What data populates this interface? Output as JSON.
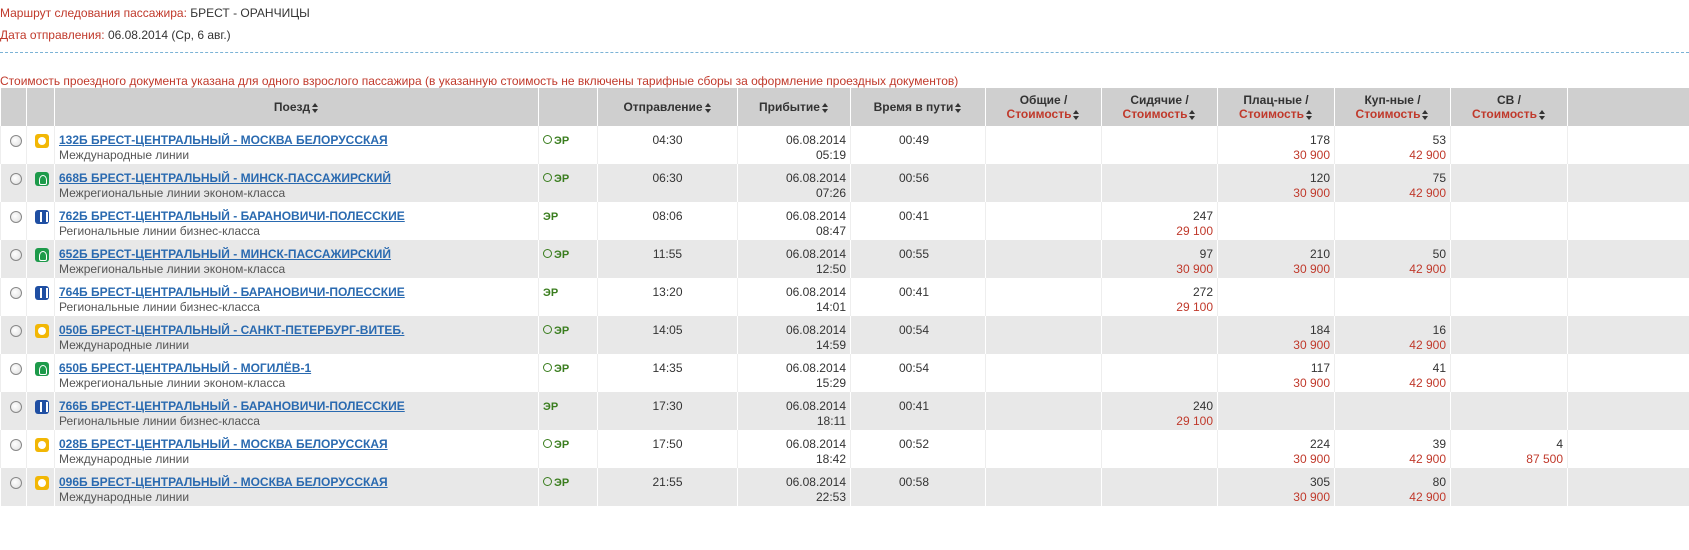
{
  "route": {
    "label": "Маршрут следования пассажира:",
    "value": "БРЕСТ - ОРАНЧИЦЫ"
  },
  "departure_date": {
    "label": "Дата отправления:",
    "value": "06.08.2014 (Ср, 6 авг.)"
  },
  "note": "Стоимость проездного документа указана для одного взрослого пассажира (в указанную стоимость не включены тарифные сборы за оформление проездных документов)",
  "headers": {
    "train": "Поезд",
    "departure": "Отправление",
    "arrival": "Прибытие",
    "travel_time": "Время в пути",
    "general": "Общие /",
    "seated": "Сидячие /",
    "platz": "Плац-ные /",
    "coupe": "Куп-ные /",
    "sv": "СВ /",
    "cost": "Стоимость"
  },
  "er_label": "ЭР",
  "trains": [
    {
      "name": "132Б БРЕСТ-ЦЕНТРАЛЬНЫЙ - МОСКВА БЕЛОРУССКАЯ",
      "category": "Международные линии",
      "icon": "intl-train-icon",
      "clock": true,
      "dep": "04:30",
      "arr_date": "06.08.2014",
      "arr_time": "05:19",
      "time": "00:49",
      "general": [
        "",
        ""
      ],
      "seated": [
        "",
        ""
      ],
      "platz": [
        "178",
        "30 900"
      ],
      "coupe": [
        "53",
        "42 900"
      ],
      "sv": [
        "",
        ""
      ]
    },
    {
      "name": "668Б БРЕСТ-ЦЕНТРАЛЬНЫЙ - МИНСК-ПАССАЖИРСКИЙ",
      "category": "Межрегиональные линии эконом-класса",
      "icon": "econ-train-icon",
      "clock": true,
      "dep": "06:30",
      "arr_date": "06.08.2014",
      "arr_time": "07:26",
      "time": "00:56",
      "general": [
        "",
        ""
      ],
      "seated": [
        "",
        ""
      ],
      "platz": [
        "120",
        "30 900"
      ],
      "coupe": [
        "75",
        "42 900"
      ],
      "sv": [
        "",
        ""
      ]
    },
    {
      "name": "762Б БРЕСТ-ЦЕНТРАЛЬНЫЙ - БАРАНОВИЧИ-ПОЛЕССКИЕ",
      "category": "Региональные линии бизнес-класса",
      "icon": "biz-train-icon",
      "clock": false,
      "dep": "08:06",
      "arr_date": "06.08.2014",
      "arr_time": "08:47",
      "time": "00:41",
      "general": [
        "",
        ""
      ],
      "seated": [
        "247",
        "29 100"
      ],
      "platz": [
        "",
        ""
      ],
      "coupe": [
        "",
        ""
      ],
      "sv": [
        "",
        ""
      ]
    },
    {
      "name": "652Б БРЕСТ-ЦЕНТРАЛЬНЫЙ - МИНСК-ПАССАЖИРСКИЙ",
      "category": "Межрегиональные линии эконом-класса",
      "icon": "econ-train-icon",
      "clock": true,
      "dep": "11:55",
      "arr_date": "06.08.2014",
      "arr_time": "12:50",
      "time": "00:55",
      "general": [
        "",
        ""
      ],
      "seated": [
        "97",
        "30 900"
      ],
      "platz": [
        "210",
        "30 900"
      ],
      "coupe": [
        "50",
        "42 900"
      ],
      "sv": [
        "",
        ""
      ]
    },
    {
      "name": "764Б БРЕСТ-ЦЕНТРАЛЬНЫЙ - БАРАНОВИЧИ-ПОЛЕССКИЕ",
      "category": "Региональные линии бизнес-класса",
      "icon": "biz-train-icon",
      "clock": false,
      "dep": "13:20",
      "arr_date": "06.08.2014",
      "arr_time": "14:01",
      "time": "00:41",
      "general": [
        "",
        ""
      ],
      "seated": [
        "272",
        "29 100"
      ],
      "platz": [
        "",
        ""
      ],
      "coupe": [
        "",
        ""
      ],
      "sv": [
        "",
        ""
      ]
    },
    {
      "name": "050Б БРЕСТ-ЦЕНТРАЛЬНЫЙ - САНКТ-ПЕТЕРБУРГ-ВИТЕБ.",
      "category": "Международные линии",
      "icon": "intl-train-icon",
      "clock": true,
      "dep": "14:05",
      "arr_date": "06.08.2014",
      "arr_time": "14:59",
      "time": "00:54",
      "general": [
        "",
        ""
      ],
      "seated": [
        "",
        ""
      ],
      "platz": [
        "184",
        "30 900"
      ],
      "coupe": [
        "16",
        "42 900"
      ],
      "sv": [
        "",
        ""
      ]
    },
    {
      "name": "650Б БРЕСТ-ЦЕНТРАЛЬНЫЙ - МОГИЛЁВ-1",
      "category": "Межрегиональные линии эконом-класса",
      "icon": "econ-train-icon",
      "clock": true,
      "dep": "14:35",
      "arr_date": "06.08.2014",
      "arr_time": "15:29",
      "time": "00:54",
      "general": [
        "",
        ""
      ],
      "seated": [
        "",
        ""
      ],
      "platz": [
        "117",
        "30 900"
      ],
      "coupe": [
        "41",
        "42 900"
      ],
      "sv": [
        "",
        ""
      ]
    },
    {
      "name": "766Б БРЕСТ-ЦЕНТРАЛЬНЫЙ - БАРАНОВИЧИ-ПОЛЕССКИЕ",
      "category": "Региональные линии бизнес-класса",
      "icon": "biz-train-icon",
      "clock": false,
      "dep": "17:30",
      "arr_date": "06.08.2014",
      "arr_time": "18:11",
      "time": "00:41",
      "general": [
        "",
        ""
      ],
      "seated": [
        "240",
        "29 100"
      ],
      "platz": [
        "",
        ""
      ],
      "coupe": [
        "",
        ""
      ],
      "sv": [
        "",
        ""
      ]
    },
    {
      "name": "028Б БРЕСТ-ЦЕНТРАЛЬНЫЙ - МОСКВА БЕЛОРУССКАЯ",
      "category": "Международные линии",
      "icon": "intl-train-icon",
      "clock": true,
      "dep": "17:50",
      "arr_date": "06.08.2014",
      "arr_time": "18:42",
      "time": "00:52",
      "general": [
        "",
        ""
      ],
      "seated": [
        "",
        ""
      ],
      "platz": [
        "224",
        "30 900"
      ],
      "coupe": [
        "39",
        "42 900"
      ],
      "sv": [
        "4",
        "87 500"
      ]
    },
    {
      "name": "096Б БРЕСТ-ЦЕНТРАЛЬНЫЙ - МОСКВА БЕЛОРУССКАЯ",
      "category": "Международные линии",
      "icon": "intl-train-icon",
      "clock": true,
      "dep": "21:55",
      "arr_date": "06.08.2014",
      "arr_time": "22:53",
      "time": "00:58",
      "general": [
        "",
        ""
      ],
      "seated": [
        "",
        ""
      ],
      "platz": [
        "305",
        "30 900"
      ],
      "coupe": [
        "80",
        "42 900"
      ],
      "sv": [
        "",
        ""
      ]
    }
  ]
}
